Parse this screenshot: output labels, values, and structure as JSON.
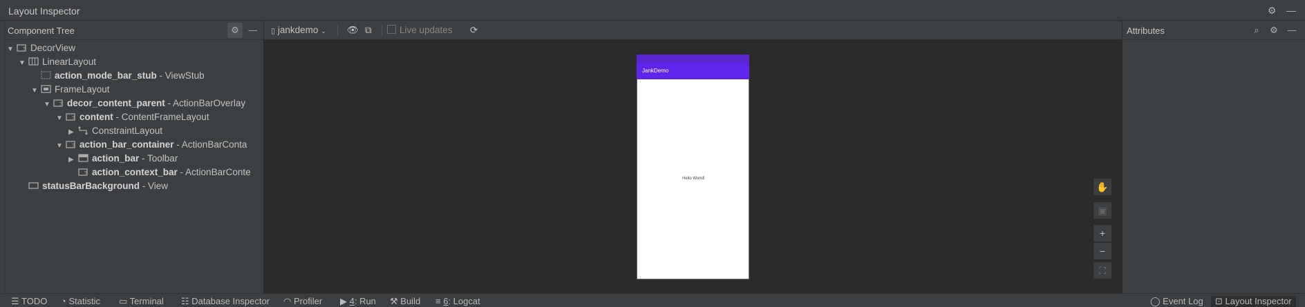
{
  "window": {
    "title": "Layout Inspector"
  },
  "component_tree": {
    "title": "Component Tree",
    "rows": [
      {
        "name": "DecorView",
        "type": ""
      },
      {
        "name": "LinearLayout",
        "type": ""
      },
      {
        "name": "action_mode_bar_stub",
        "type": " - ViewStub"
      },
      {
        "name": "FrameLayout",
        "type": ""
      },
      {
        "name": "decor_content_parent",
        "type": " - ActionBarOverlay"
      },
      {
        "name": "content",
        "type": " - ContentFrameLayout"
      },
      {
        "name": "ConstraintLayout",
        "type": ""
      },
      {
        "name": "action_bar_container",
        "type": " - ActionBarConta"
      },
      {
        "name": "action_bar",
        "type": " - Toolbar"
      },
      {
        "name": "action_context_bar",
        "type": " - ActionBarConte"
      },
      {
        "name": "statusBarBackground",
        "type": " - View"
      }
    ]
  },
  "toolbar": {
    "process": "jankdemo",
    "live_updates_label": "Live updates",
    "live_updates_checked": false
  },
  "device": {
    "app_title": "JankDemo",
    "body_text": "Hello World!",
    "accent_color": "#6124ec"
  },
  "zoom": {
    "plus": "+",
    "minus": "−"
  },
  "attributes": {
    "title": "Attributes"
  },
  "bottom_bar": {
    "todo": "TODO",
    "statistic": "Statistic",
    "terminal": "Terminal",
    "database_inspector": "Database Inspector",
    "profiler": "Profiler",
    "run_num": "4",
    "run": ": Run",
    "build": "Build",
    "logcat_num": "6",
    "logcat": ": Logcat",
    "event_log": "Event Log",
    "layout_inspector": "Layout Inspector"
  }
}
